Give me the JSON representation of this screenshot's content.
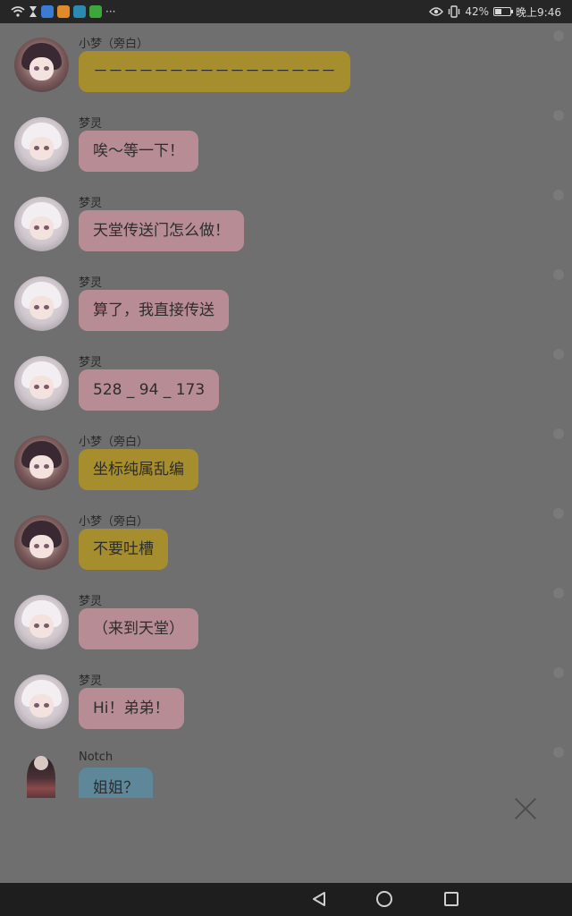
{
  "status_bar": {
    "left_more": "···",
    "battery_percent": "42%",
    "battery_level": 0.42,
    "time": "晚上9:46",
    "icons": [
      "wifi-icon",
      "hourglass-icon",
      "app-blue-icon",
      "app-orange-icon",
      "app-teal-icon",
      "app-green-icon",
      "eye-icon",
      "vibrate-icon",
      "battery-icon"
    ]
  },
  "messages": [
    {
      "speaker": "小梦（旁白）",
      "text": "－－－－－－－－－－－－－－－－",
      "role": "xiao"
    },
    {
      "speaker": "梦灵",
      "text": "唉～等一下！",
      "role": "meng"
    },
    {
      "speaker": "梦灵",
      "text": "天堂传送门怎么做！",
      "role": "meng"
    },
    {
      "speaker": "梦灵",
      "text": "算了，我直接传送",
      "role": "meng"
    },
    {
      "speaker": "梦灵",
      "text": "528 _ 94 _ 173",
      "role": "meng"
    },
    {
      "speaker": "小梦（旁白）",
      "text": "坐标纯属乱编",
      "role": "xiao"
    },
    {
      "speaker": "小梦（旁白）",
      "text": "不要吐槽",
      "role": "xiao"
    },
    {
      "speaker": "梦灵",
      "text": "（来到天堂）",
      "role": "meng"
    },
    {
      "speaker": "梦灵",
      "text": "Hi！弟弟！",
      "role": "meng"
    },
    {
      "speaker": "Notch",
      "text": "姐姐？",
      "role": "notch"
    }
  ],
  "close_icon": "close-icon",
  "nav_bar": {
    "icons": [
      "back-icon",
      "home-icon",
      "recents-icon"
    ]
  },
  "colors": {
    "bubble_meng": "#b88c94",
    "bubble_xiao": "#a68d2d",
    "bubble_notch": "#5e8799",
    "background": "#6f6f6f"
  }
}
